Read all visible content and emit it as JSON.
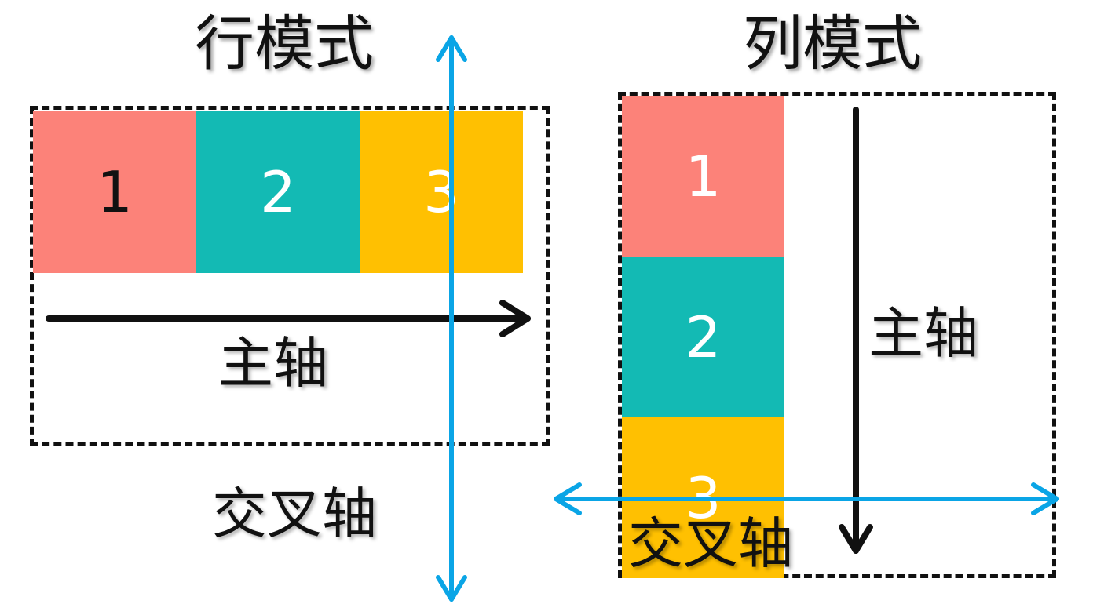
{
  "row_mode": {
    "title": "行模式",
    "items": [
      {
        "label": "1",
        "color": "#fc8279",
        "text_color": "#111111"
      },
      {
        "label": "2",
        "color": "#13bab4",
        "text_color": "#ffffff"
      },
      {
        "label": "3",
        "color": "#ffc001",
        "text_color": "#ffffff"
      }
    ],
    "main_axis_label": "主轴",
    "cross_axis_label": "交叉轴"
  },
  "column_mode": {
    "title": "列模式",
    "items": [
      {
        "label": "1",
        "color": "#fc8279",
        "text_color": "#ffffff"
      },
      {
        "label": "2",
        "color": "#13bab4",
        "text_color": "#ffffff"
      },
      {
        "label": "3",
        "color": "#ffc001",
        "text_color": "#ffffff"
      }
    ],
    "main_axis_label": "主轴",
    "cross_axis_label": "交叉轴"
  },
  "colors": {
    "cross_axis_arrow": "#0aa5e6",
    "main_axis_arrow": "#111111",
    "frame": "#111111"
  }
}
